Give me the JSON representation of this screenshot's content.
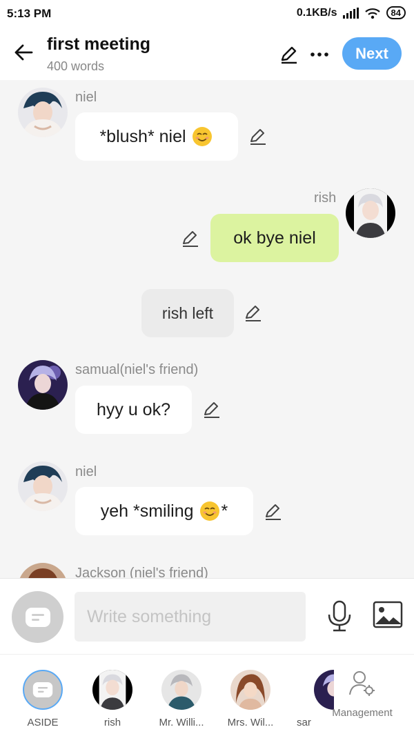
{
  "status_bar": {
    "time": "5:13 PM",
    "network_speed": "0.1KB/s",
    "battery": "84"
  },
  "header": {
    "title": "first meeting",
    "word_count": "400 words",
    "next_label": "Next"
  },
  "messages": [
    {
      "sender": "niel",
      "text_before": "*blush* niel",
      "emoji": "smiling-face",
      "text_after": ""
    },
    {
      "sender": "rish",
      "text": "ok bye niel"
    },
    {
      "text": "rish left"
    },
    {
      "sender": "samual(niel's friend)",
      "text": "hyy u ok?"
    },
    {
      "sender": "niel",
      "text_before": "yeh *smiling",
      "emoji": "smiling-face",
      "text_after": "*"
    },
    {
      "sender": "Jackson (niel's friend)"
    }
  ],
  "composer": {
    "placeholder": "Write something"
  },
  "characters": [
    {
      "label": "ASIDE"
    },
    {
      "label": "rish"
    },
    {
      "label": "Mr. Willi..."
    },
    {
      "label": "Mrs. Wil..."
    },
    {
      "label": "sar"
    }
  ],
  "management_label": "Management",
  "colors": {
    "accent": "#59a9f5",
    "my_bubble": "#dcf3a0",
    "background": "#f5f5f5"
  }
}
